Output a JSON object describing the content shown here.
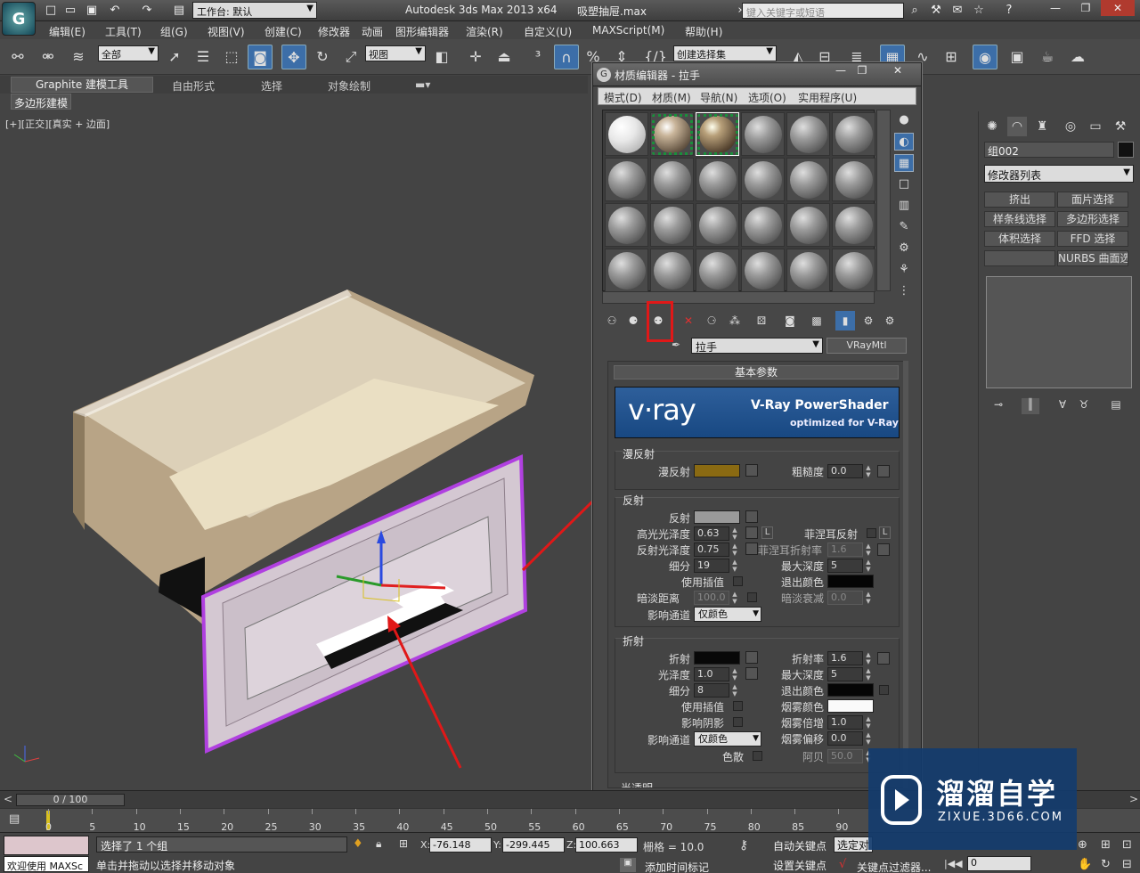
{
  "titlebar": {
    "app_title": "Autodesk 3ds Max  2013 x64",
    "file_name": "吸塑抽屉.max",
    "workspace": "工作台: 默认",
    "search_placeholder": "键入关键字或短语",
    "logo_text": "G",
    "controls": [
      "—",
      "❐",
      "✕"
    ]
  },
  "menubar": [
    "编辑(E)",
    "工具(T)",
    "组(G)",
    "视图(V)",
    "创建(C)",
    "修改器",
    "动画",
    "图形编辑器",
    "渲染(R)",
    "自定义(U)",
    "MAXScript(M)",
    "帮助(H)"
  ],
  "toolbar": {
    "selection_filter": "全部",
    "ref_coord": "视图",
    "named_selection": "创建选择集"
  },
  "ribbon": {
    "tabs": [
      "Graphite 建模工具",
      "自由形式",
      "选择",
      "对象绘制"
    ],
    "subtab": "多边形建模"
  },
  "viewport": {
    "label": "[+][正交][真实 + 边面]"
  },
  "material_editor": {
    "title": "材质编辑器 - 拉手",
    "menu": [
      "模式(D)",
      "材质(M)",
      "导航(N)",
      "选项(O)",
      "实用程序(U)"
    ],
    "material_name": "拉手",
    "material_type": "VRayMtl",
    "rollout_title": "基本参数",
    "vray_banner": {
      "logo": "v·ray",
      "line1": "V-Ray PowerShader",
      "line2": "optimized for V-Ray"
    },
    "colors": {
      "diffuse": "#8a6a12",
      "reflect": "#9a9a9a",
      "refract": "#080808",
      "exit": "#050505",
      "fog": "#fafafa",
      "exit2": "#050505"
    },
    "diffuse_group": {
      "title": "漫反射",
      "diffuse_label": "漫反射",
      "roughness_label": "粗糙度",
      "roughness": "0.0"
    },
    "reflection_group": {
      "title": "反射",
      "reflect_label": "反射",
      "hilight_label": "高光光泽度",
      "hilight": "0.63",
      "lock_label": "L",
      "refl_gloss_label": "反射光泽度",
      "refl_gloss": "0.75",
      "subdivs_label": "细分",
      "subdivs": "19",
      "interp_label": "使用插值",
      "dim_dist_label": "暗淡距离",
      "dim_dist": "100.0",
      "affect_label": "影响通道",
      "affect": "仅颜色",
      "fresnel_label": "菲涅耳反射",
      "fresnel_ior_label": "菲涅耳折射率",
      "fresnel_ior": "1.6",
      "max_depth_label": "最大深度",
      "max_depth": "5",
      "exit_label": "退出颜色",
      "dim_falloff_label": "暗淡衰减",
      "dim_falloff": "0.0"
    },
    "refraction_group": {
      "title": "折射",
      "refract_label": "折射",
      "gloss_label": "光泽度",
      "gloss": "1.0",
      "subdivs_label": "细分",
      "subdivs": "8",
      "interp_label": "使用插值",
      "shadows_label": "影响阴影",
      "affect_label": "影响通道",
      "affect": "仅颜色",
      "dispersion_label": "色散",
      "ior_label": "折射率",
      "ior": "1.6",
      "max_depth_label": "最大深度",
      "max_depth": "5",
      "exit_label": "退出颜色",
      "fog_color_label": "烟雾颜色",
      "fog_mult_label": "烟雾倍增",
      "fog_mult": "1.0",
      "fog_bias_label": "烟雾偏移",
      "fog_bias": "0.0",
      "abbe_label": "阿贝",
      "abbe": "50.0"
    },
    "next_group": "半透明"
  },
  "command_panel": {
    "object_name": "组002",
    "modifier_list": "修改器列表",
    "buttons": [
      "挤出",
      "面片选择",
      "样条线选择",
      "多边形选择",
      "体积选择",
      "FFD 选择",
      "",
      "NURBS 曲面选择"
    ]
  },
  "timeline": {
    "slider": "0 / 100",
    "ticks": [
      "0",
      "5",
      "10",
      "15",
      "20",
      "25",
      "30",
      "35",
      "40",
      "45",
      "50",
      "55",
      "60",
      "65",
      "70",
      "75",
      "80",
      "85",
      "90"
    ]
  },
  "status": {
    "welcome": "欢迎使用 MAXSc",
    "selection_msg": "选择了 1 个组",
    "prompt": "单击并拖动以选择并移动对象",
    "x_label": "X:",
    "x": "-76.148",
    "y_label": "Y:",
    "y": "-299.445",
    "z_label": "Z:",
    "z": "100.663",
    "grid": "栅格 = 10.0",
    "auto_key": "自动关键点",
    "set_key": "设置关键点",
    "sel_set": "选定对",
    "add_time_tag": "添加时间标记",
    "key_filters": "关键点过滤器...",
    "frame": "0"
  },
  "watermark": {
    "cn": "溜溜自学",
    "en": "ZIXUE.3D66.COM"
  }
}
